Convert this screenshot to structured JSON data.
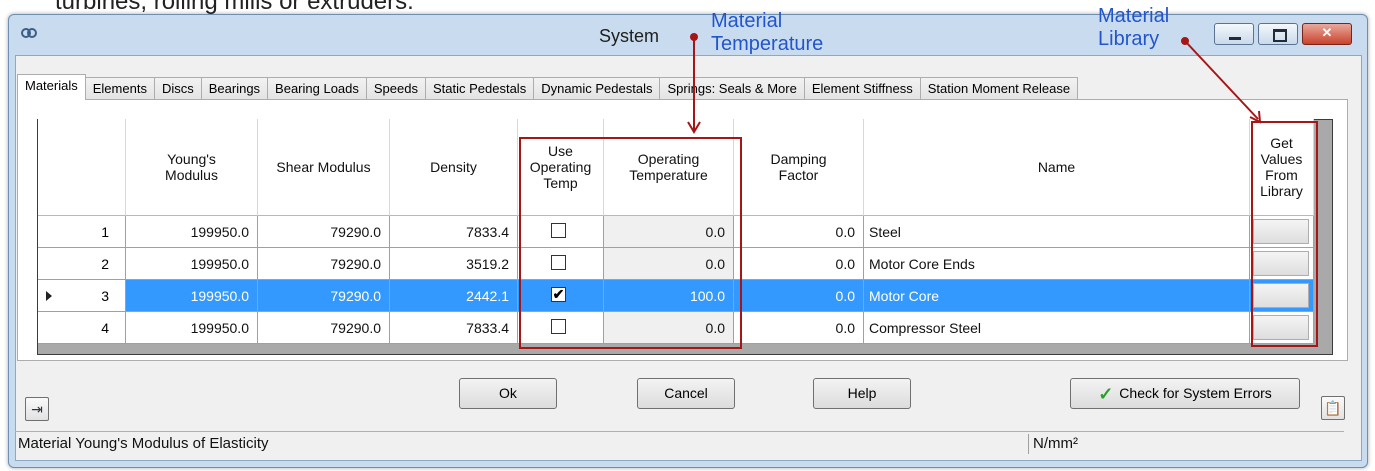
{
  "top_text": "turbines, rolling mills or extruders.",
  "window": {
    "title": "System",
    "controls": {
      "minimize": "minimize-icon",
      "maximize": "maximize-icon",
      "close": "✕"
    }
  },
  "tabs": [
    "Materials",
    "Elements",
    "Discs",
    "Bearings",
    "Bearing Loads",
    "Speeds",
    "Static Pedestals",
    "Dynamic Pedestals",
    "Springs: Seals & More",
    "Element Stiffness",
    "Station Moment Release"
  ],
  "active_tab": "Materials",
  "grid": {
    "columns": [
      "Young's Modulus",
      "Shear Modulus",
      "Density",
      "Use Operating Temp",
      "Operating Temperature",
      "Damping Factor",
      "Name",
      "Get Values From Library"
    ],
    "rows": [
      {
        "index": "1",
        "youngs": "199950.0",
        "shear": "79290.0",
        "density": "7833.4",
        "use_temp": false,
        "op_temp": "0.0",
        "damping": "0.0",
        "name": "Steel"
      },
      {
        "index": "2",
        "youngs": "199950.0",
        "shear": "79290.0",
        "density": "3519.2",
        "use_temp": false,
        "op_temp": "0.0",
        "damping": "0.0",
        "name": "Motor Core Ends"
      },
      {
        "index": "3",
        "youngs": "199950.0",
        "shear": "79290.0",
        "density": "2442.1",
        "use_temp": true,
        "op_temp": "100.0",
        "damping": "0.0",
        "name": "Motor Core",
        "selected": true
      },
      {
        "index": "4",
        "youngs": "199950.0",
        "shear": "79290.0",
        "density": "7833.4",
        "use_temp": false,
        "op_temp": "0.0",
        "damping": "0.0",
        "name": "Compressor Steel"
      }
    ]
  },
  "buttons": {
    "ok": "Ok",
    "cancel": "Cancel",
    "help": "Help",
    "check": "Check for System Errors"
  },
  "status": {
    "message": "Material Young's Modulus of Elasticity",
    "units": "N/mm²"
  },
  "annotations": {
    "temperature": [
      "Material",
      "Temperature"
    ],
    "library": [
      "Material",
      "Library"
    ]
  },
  "colors": {
    "selection": "#3399ff",
    "annotation_text": "#2255cc",
    "annotation_box": "#a61616"
  }
}
